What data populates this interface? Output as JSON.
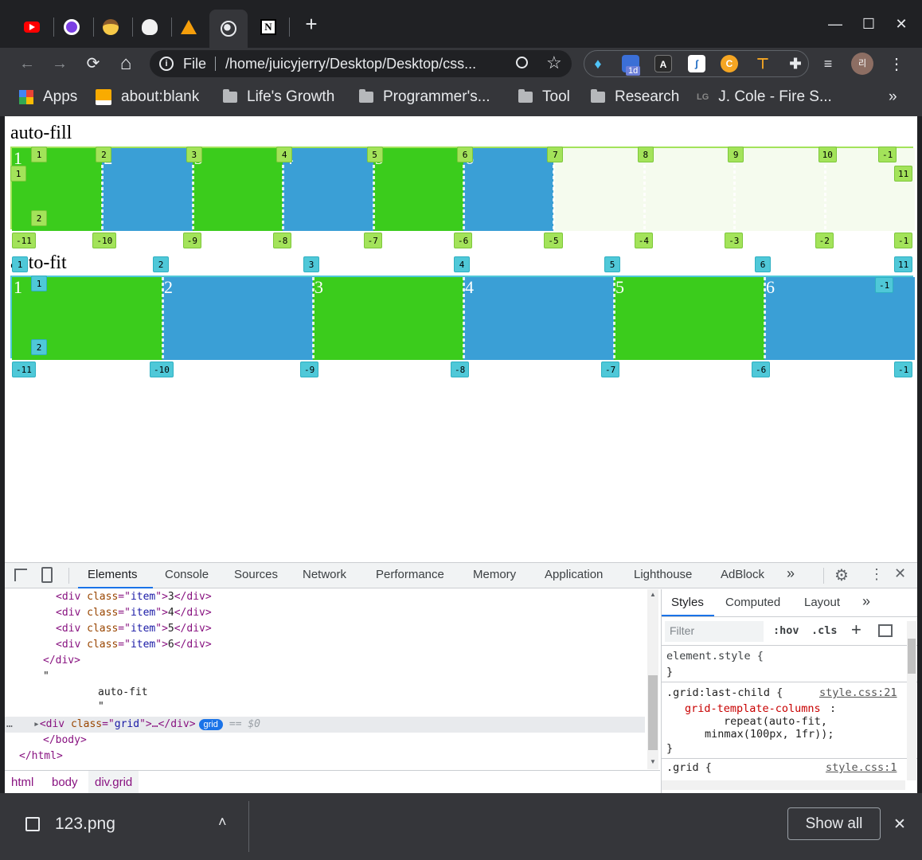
{
  "window": {
    "tabs": [
      {
        "icon": "youtube-icon"
      },
      {
        "icon": "circle-app-icon"
      },
      {
        "icon": "cowboy-emoji-icon"
      },
      {
        "icon": "skull-icon"
      },
      {
        "icon": "triangle-logo-icon"
      },
      {
        "icon": "globe-icon",
        "active": true
      },
      {
        "icon": "notion-icon"
      }
    ],
    "new_tab_label": "+",
    "minimize": "—",
    "maximize": "☐",
    "close": "✕"
  },
  "toolbar": {
    "back": "←",
    "forward": "→",
    "reload": "⟳",
    "home": "⌂",
    "info_icon": "i",
    "scheme": "File",
    "url": "/home/juicyjerry/Desktop/Desktop/css...",
    "ext_badge": "1d",
    "profile_initial": "리"
  },
  "bookmarks": [
    {
      "label": "Apps",
      "icon": "apps-grid-icon"
    },
    {
      "label": "about:blank",
      "icon": "page-icon"
    },
    {
      "label": "Life's Growth",
      "icon": "folder-icon"
    },
    {
      "label": "Programmer's...",
      "icon": "folder-icon"
    },
    {
      "label": "Tool",
      "icon": "folder-icon"
    },
    {
      "label": "Research",
      "icon": "folder-icon"
    },
    {
      "label": "J. Cole - Fire S...",
      "icon": "lg-icon"
    }
  ],
  "bookmarks_more": "»",
  "page": {
    "autofill": {
      "heading": "auto-fill",
      "cells": [
        "1",
        "2",
        "3",
        "4",
        "5",
        "6"
      ],
      "top_labels": [
        "1",
        "2",
        "3",
        "4",
        "5",
        "6",
        "7",
        "8",
        "9",
        "10",
        "-1"
      ],
      "bottom_labels": [
        "-11",
        "-10",
        "-9",
        "-8",
        "-7",
        "-6",
        "-5",
        "-4",
        "-3",
        "-2",
        "-1"
      ],
      "row_labels": [
        "1",
        "2"
      ],
      "right_label": "11"
    },
    "autofit": {
      "heading": "auto-fit",
      "cells": [
        "1",
        "2",
        "3",
        "4",
        "5",
        "6"
      ],
      "top_labels": [
        "1",
        "2",
        "3",
        "4",
        "5",
        "6",
        "11"
      ],
      "bottom_labels": [
        "-11",
        "-10",
        "-9",
        "-8",
        "-7",
        "-6",
        "-1"
      ],
      "row_labels": [
        "1",
        "2"
      ],
      "inner_label": "-1"
    }
  },
  "devtools": {
    "tabs": [
      "Elements",
      "Console",
      "Sources",
      "Network",
      "Performance",
      "Memory",
      "Application",
      "Lighthouse",
      "AdBlock"
    ],
    "more": "»",
    "dom": {
      "item_lines": [
        {
          "open": "<div ",
          "attr": "class",
          "eq": "=\"",
          "val": "item",
          "close": "\">",
          "text": "3",
          "end": "</div>"
        },
        {
          "open": "<div ",
          "attr": "class",
          "eq": "=\"",
          "val": "item",
          "close": "\">",
          "text": "4",
          "end": "</div>"
        },
        {
          "open": "<div ",
          "attr": "class",
          "eq": "=\"",
          "val": "item",
          "close": "\">",
          "text": "5",
          "end": "</div>"
        },
        {
          "open": "<div ",
          "attr": "class",
          "eq": "=\"",
          "val": "item",
          "close": "\">",
          "text": "6",
          "end": "</div>"
        }
      ],
      "div_close": "</div>",
      "quote1": "\"",
      "text_node": "auto-fit",
      "quote2": "\"",
      "sel_open": "<div ",
      "sel_attr": "class",
      "sel_val": "grid",
      "sel_rest": "…</div>",
      "sel_badge": "grid",
      "sel_marker": "== $0",
      "body_close": "</body>",
      "html_close": "</html>"
    },
    "breadcrumbs": [
      "html",
      "body",
      "div.grid"
    ],
    "styles_tabs": [
      "Styles",
      "Computed",
      "Layout"
    ],
    "styles_more": "»",
    "filter_placeholder": "Filter",
    "hov": ":hov",
    "cls": ".cls",
    "rules": {
      "element_style": "element.style {",
      "close_brace": "}",
      "rule1_selector": ".grid:last-child {",
      "rule1_link": "style.css:21",
      "rule1_prop": "grid-template-columns",
      "rule1_val1": "repeat(auto-fit,",
      "rule1_val2": "minmax(100px, 1fr));",
      "rule2_selector": ".grid {",
      "rule2_link": "style.css:1"
    }
  },
  "download_bar": {
    "filename": "123.png",
    "show_all": "Show all",
    "close": "✕"
  },
  "colors": {
    "green_cell": "#3bcc1c",
    "blue_cell": "#3a9fd6",
    "autofill_overlay": "#a3e35a",
    "autofit_overlay": "#4fc8d8"
  }
}
